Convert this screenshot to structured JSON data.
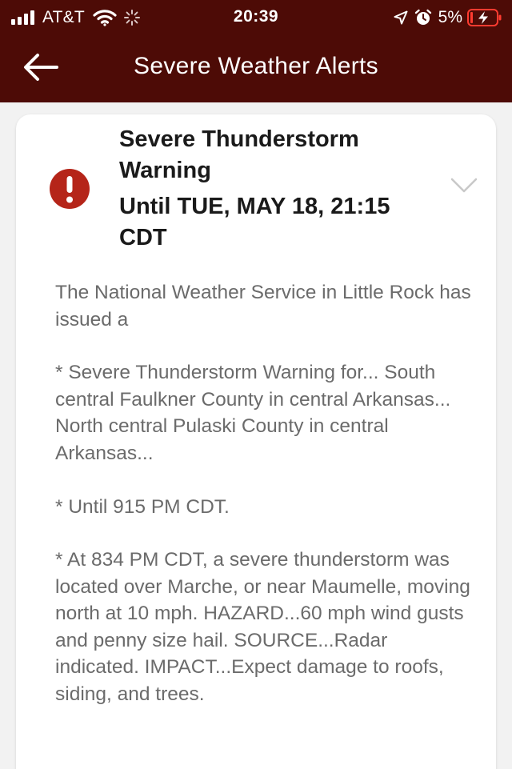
{
  "status_bar": {
    "carrier": "AT&T",
    "time": "20:39",
    "battery_percent": "5%",
    "icons": [
      "signal-icon",
      "wifi-icon",
      "activity-spinner-icon",
      "location-arrow-icon",
      "alarm-clock-icon",
      "battery-charging-icon"
    ]
  },
  "nav": {
    "title": "Severe Weather Alerts",
    "back_icon": "back-arrow-icon"
  },
  "alert": {
    "icon": "exclamation-circle-icon",
    "title": "Severe Thunderstorm Warning",
    "until": "Until TUE, MAY 18, 21:15 CDT",
    "expand_icon": "chevron-down-icon",
    "paragraphs": [
      "The National Weather Service in Little Rock has issued a",
      "* Severe Thunderstorm Warning for... South central Faulkner County in central Arkansas... North central Pulaski County in central Arkansas...",
      "* Until 915 PM CDT.",
      "* At 834 PM CDT, a severe thunderstorm was located over Marche, or near Maumelle, moving north at 10 mph. HAZARD...60 mph wind gusts and penny size hail. SOURCE...Radar indicated. IMPACT...Expect damage to roofs, siding, and trees."
    ]
  },
  "colors": {
    "header_bg": "#4d0b06",
    "alert_icon_red": "#b52519",
    "body_text": "#6b6b6b",
    "page_bg": "#f2f2f2"
  }
}
